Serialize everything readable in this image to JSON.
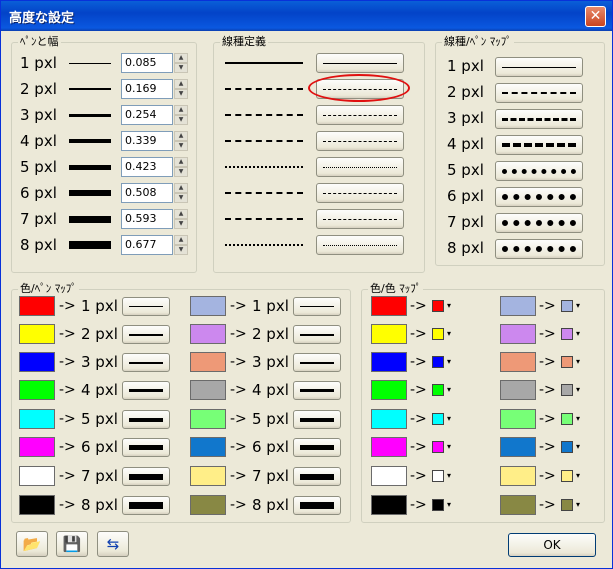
{
  "window": {
    "title": "高度な設定",
    "close_glyph": "✕"
  },
  "pen_width": {
    "label": "ﾍﾟﾝと幅",
    "rows": [
      {
        "label": "1 pxl",
        "value": "0.085",
        "width": 1
      },
      {
        "label": "2 pxl",
        "value": "0.169",
        "width": 2
      },
      {
        "label": "3 pxl",
        "value": "0.254",
        "width": 3
      },
      {
        "label": "4 pxl",
        "value": "0.339",
        "width": 4
      },
      {
        "label": "5 pxl",
        "value": "0.423",
        "width": 5
      },
      {
        "label": "6 pxl",
        "value": "0.508",
        "width": 6
      },
      {
        "label": "7 pxl",
        "value": "0.593",
        "width": 7
      },
      {
        "label": "8 pxl",
        "value": "0.677",
        "width": 8
      }
    ]
  },
  "linetype_def": {
    "label": "線種定義",
    "rows": [
      {
        "pattern": "solid"
      },
      {
        "pattern": "dashed"
      },
      {
        "pattern": "dashdot"
      },
      {
        "pattern": "dashdotdot"
      },
      {
        "pattern": "dotted"
      },
      {
        "pattern": "longdash"
      },
      {
        "pattern": "dash3"
      },
      {
        "pattern": "dotdash"
      }
    ],
    "highlight_color": "#e01010"
  },
  "linetype_map": {
    "label": "線種/ﾍﾟﾝ ﾏｯﾌﾟ",
    "rows": [
      {
        "label": "1 pxl"
      },
      {
        "label": "2 pxl"
      },
      {
        "label": "3 pxl"
      },
      {
        "label": "4 pxl"
      },
      {
        "label": "5 pxl"
      },
      {
        "label": "6 pxl"
      },
      {
        "label": "7 pxl"
      },
      {
        "label": "8 pxl"
      }
    ]
  },
  "color_pen_map": {
    "label": "色/ﾍﾟﾝ ﾏｯﾌﾟ",
    "arrow": "->",
    "left": [
      {
        "color": "#ff0000",
        "pen": "1 pxl",
        "width": 1
      },
      {
        "color": "#ffff00",
        "pen": "2 pxl",
        "width": 2
      },
      {
        "color": "#0000ff",
        "pen": "3 pxl",
        "width": 2
      },
      {
        "color": "#00ff00",
        "pen": "4 pxl",
        "width": 3
      },
      {
        "color": "#00ffff",
        "pen": "5 pxl",
        "width": 4
      },
      {
        "color": "#ff00ff",
        "pen": "6 pxl",
        "width": 5
      },
      {
        "color": "#ffffff",
        "pen": "7 pxl",
        "width": 6
      },
      {
        "color": "#000000",
        "pen": "8 pxl",
        "width": 7
      }
    ],
    "right": [
      {
        "color": "#a4b4e0",
        "pen": "1 pxl",
        "width": 1
      },
      {
        "color": "#cc88ee",
        "pen": "2 pxl",
        "width": 2
      },
      {
        "color": "#ee9977",
        "pen": "3 pxl",
        "width": 2
      },
      {
        "color": "#a8a8a8",
        "pen": "4 pxl",
        "width": 3
      },
      {
        "color": "#77ff77",
        "pen": "5 pxl",
        "width": 4
      },
      {
        "color": "#1177cc",
        "pen": "6 pxl",
        "width": 5
      },
      {
        "color": "#ffee88",
        "pen": "7 pxl",
        "width": 6
      },
      {
        "color": "#888844",
        "pen": "8 pxl",
        "width": 7
      }
    ]
  },
  "color_color_map": {
    "label": "色/色 ﾏｯﾌﾟ",
    "arrow": "->",
    "dropdown_glyph": "▾",
    "left": [
      "#ff0000",
      "#ffff00",
      "#0000ff",
      "#00ff00",
      "#00ffff",
      "#ff00ff",
      "#ffffff",
      "#000000"
    ],
    "right": [
      "#a4b4e0",
      "#cc88ee",
      "#ee9977",
      "#a8a8a8",
      "#77ff77",
      "#1177cc",
      "#ffee88",
      "#888844"
    ]
  },
  "toolbar": {
    "open_icon": "folder-open-icon",
    "save_icon": "floppy-disk-icon",
    "import_icon": "list-transfer-icon",
    "open_glyph": "📂",
    "save_glyph": "💾",
    "import_glyph": "⇆"
  },
  "ok_label": "OK"
}
